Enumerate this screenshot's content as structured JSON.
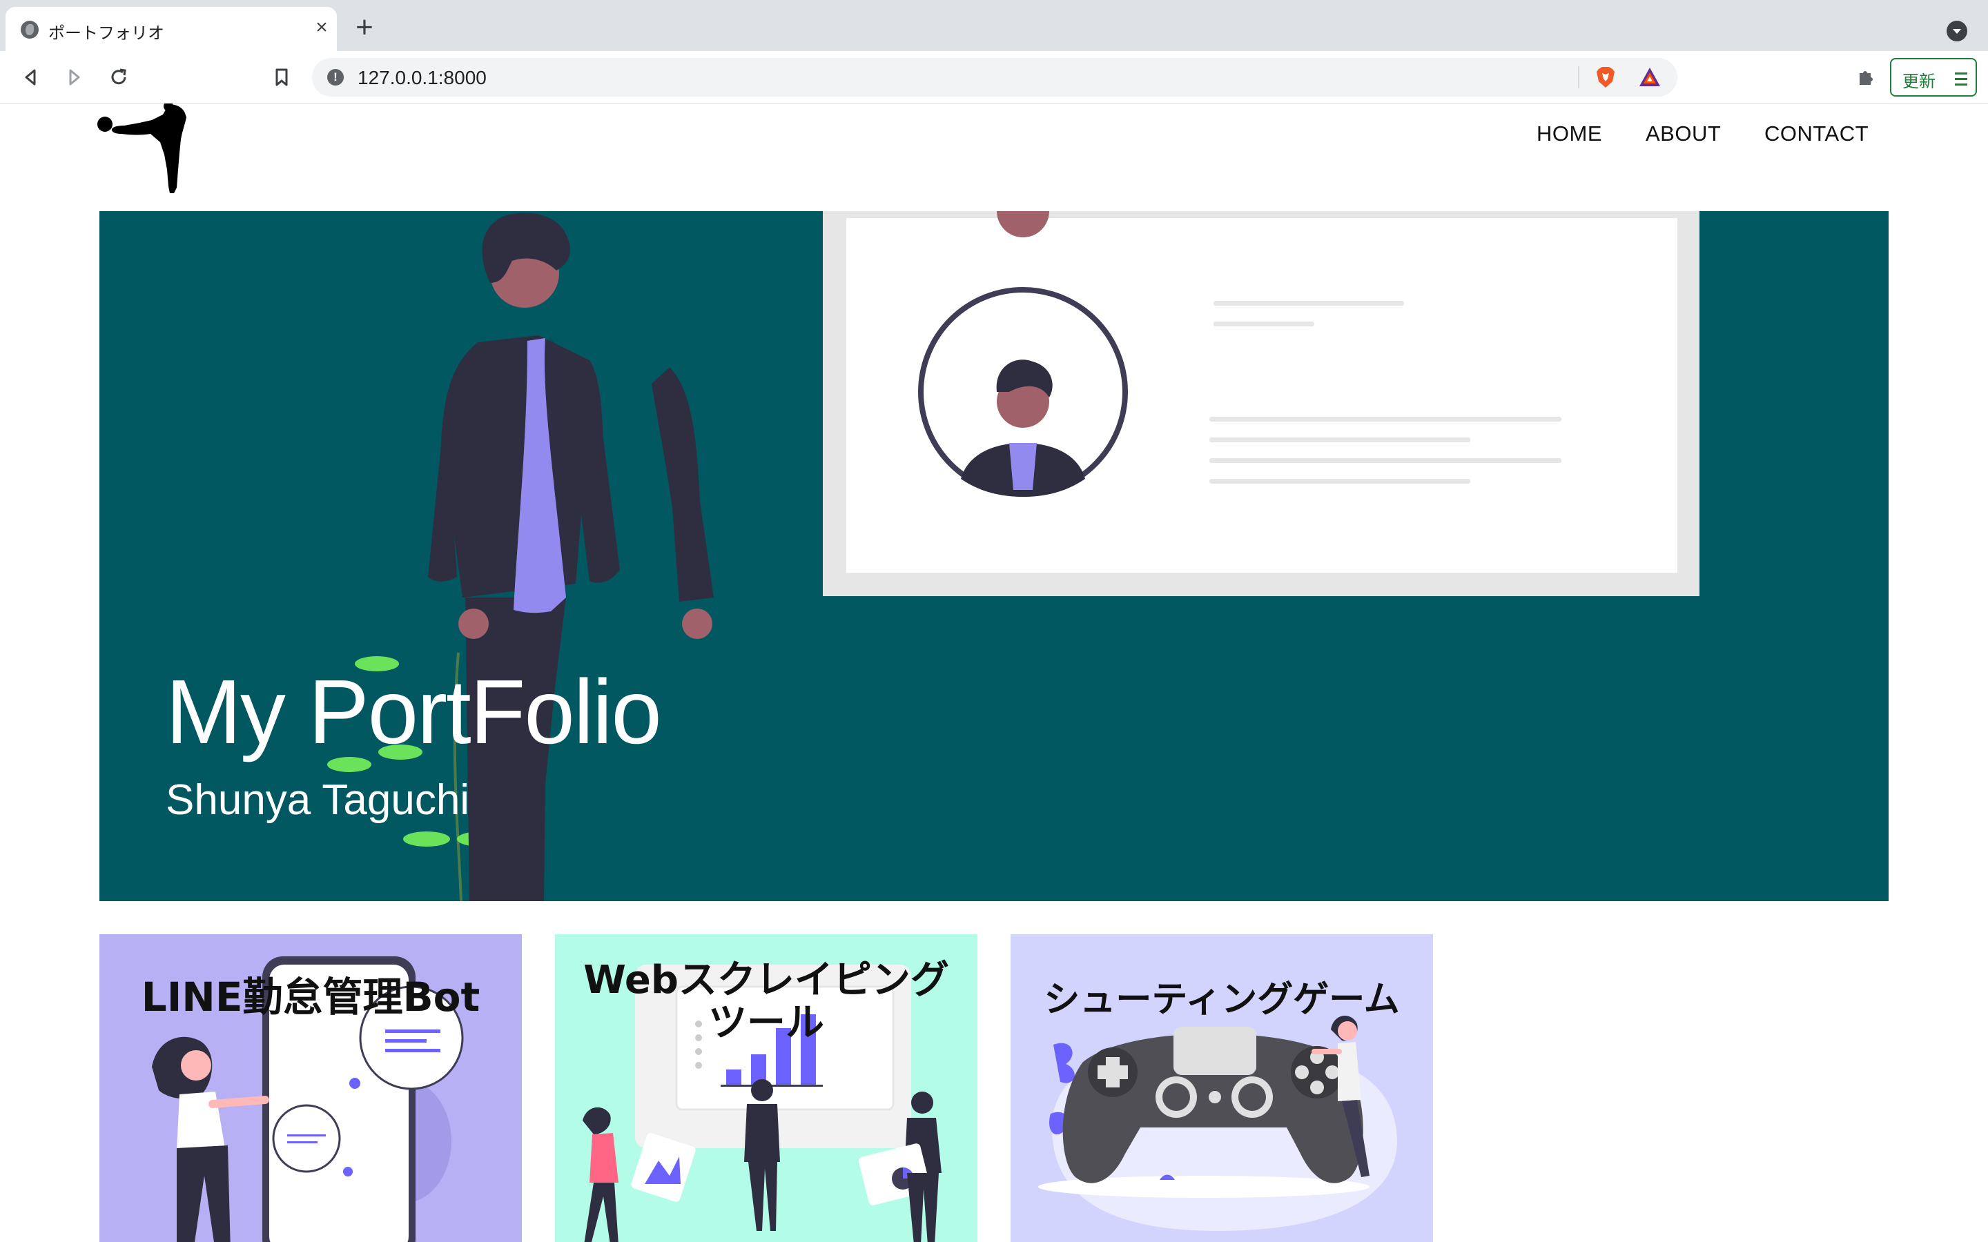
{
  "browser": {
    "tab_title": "ポートフォリオ",
    "tab_close": "×",
    "new_tab": "+",
    "url": "127.0.0.1:8000",
    "update_label": "更新",
    "icons": [
      "back-icon",
      "forward-icon",
      "reload-icon",
      "bookmark-icon",
      "info-icon",
      "brave-shields-icon",
      "brave-rewards-icon",
      "extensions-icon",
      "menu-icon"
    ]
  },
  "nav": {
    "home": "HOME",
    "about": "ABOUT",
    "contact": "CONTACT"
  },
  "hero": {
    "title": "My PortFolio",
    "subtitle": "Shunya Taguchi",
    "background_color": "#015860"
  },
  "cards": [
    {
      "title": "LINE勤怠管理Bot",
      "background_color": "#b7b0f5"
    },
    {
      "title_line1": "Webスクレイピング",
      "title_line2": "ツール",
      "background_color": "#b3fce8"
    },
    {
      "title": "シューティングゲーム",
      "background_color": "#d2d4fe"
    }
  ]
}
